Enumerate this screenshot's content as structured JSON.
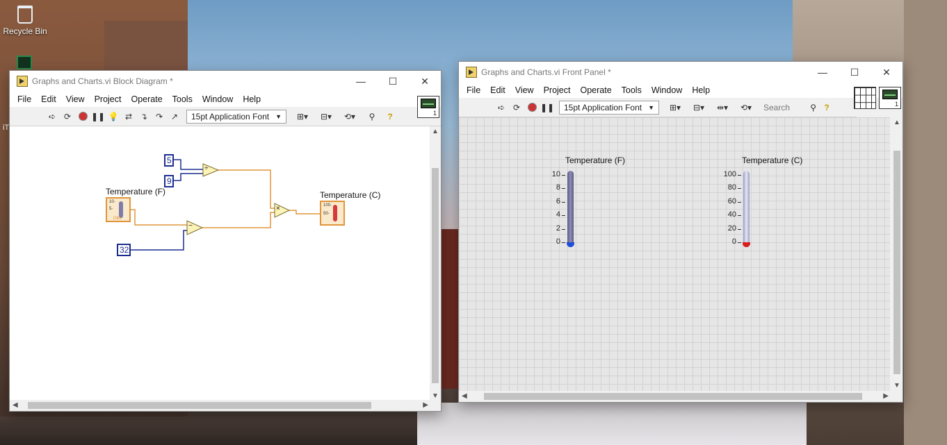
{
  "desktop": {
    "recycle_bin_label": "Recycle Bin",
    "side_label": "iT"
  },
  "block_diagram": {
    "title": "Graphs and Charts.vi Block Diagram *",
    "menu": [
      "File",
      "Edit",
      "View",
      "Project",
      "Operate",
      "Tools",
      "Window",
      "Help"
    ],
    "font": "15pt Application Font",
    "vi_icon_number": "1",
    "constants": {
      "c5": "5",
      "c9": "9",
      "c32": "32"
    },
    "nodes": {
      "divide_symbol": "÷",
      "subtract_symbol": "−",
      "multiply_symbol": "×"
    },
    "terminals": {
      "input_label": "Temperature (F)",
      "input_type": "DBL",
      "input_ticks": [
        "10-",
        "5-"
      ],
      "output_label": "Temperature (C)",
      "output_ticks": [
        "100-",
        "50-"
      ]
    }
  },
  "front_panel": {
    "title": "Graphs and Charts.vi Front Panel *",
    "menu": [
      "File",
      "Edit",
      "View",
      "Project",
      "Operate",
      "Tools",
      "Window",
      "Help"
    ],
    "font": "15pt Application Font",
    "search_placeholder": "Search",
    "vi_icon_number": "1",
    "thermometer_f": {
      "label": "Temperature (F)",
      "ticks": [
        "10",
        "8",
        "6",
        "4",
        "2",
        "0"
      ],
      "value": 0,
      "bulb_color": "#1e4fd8"
    },
    "thermometer_c": {
      "label": "Temperature (C)",
      "ticks": [
        "100",
        "80",
        "60",
        "40",
        "20",
        "0"
      ],
      "value": 0,
      "bulb_color": "#d81e1e"
    }
  },
  "window_controls": {
    "minimize": "—",
    "maximize": "☐",
    "close": "✕"
  }
}
